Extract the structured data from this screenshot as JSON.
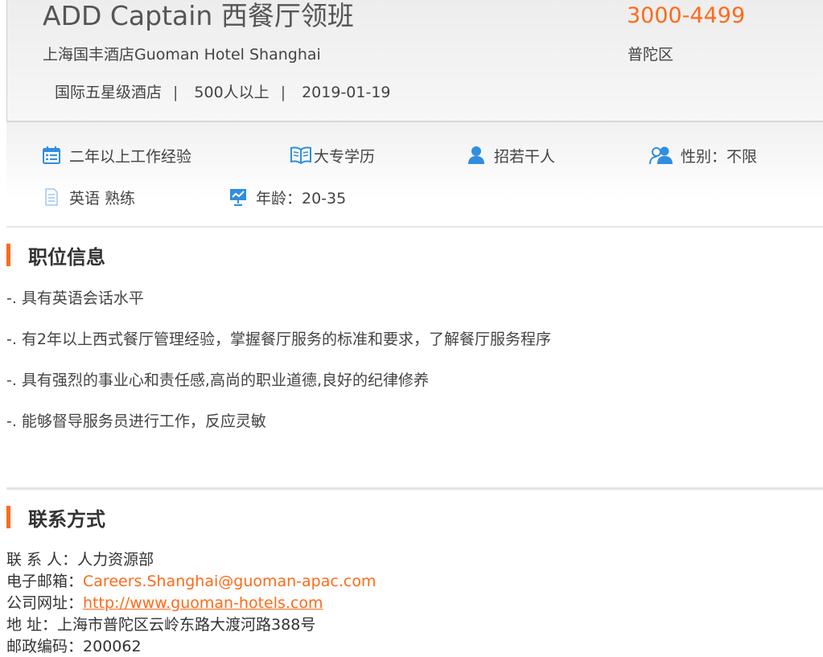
{
  "job": {
    "title": "ADD Captain 西餐厅领班",
    "salary": "3000-4499",
    "company": "上海国丰酒店Guoman Hotel Shanghai",
    "district": "普陀区",
    "company_type": "国际五星级酒店",
    "separator": "|",
    "company_size": "500人以上",
    "post_date": "2019-01-19"
  },
  "requirements": {
    "experience": "二年以上工作经验",
    "education": "大专学历",
    "headcount": "招若干人",
    "gender": "性别：不限",
    "language": "英语 熟练",
    "age": "年龄：20-35"
  },
  "icons": {
    "experience": "calendar-icon",
    "education": "open-book-icon",
    "headcount": "person-icon",
    "gender": "people-icon",
    "language": "document-icon",
    "age": "chart-board-icon",
    "icon_color": "#2f8ee0"
  },
  "sections": {
    "position_info": {
      "title": "职位信息",
      "items": [
        "-. 具有英语会话水平",
        "-. 有2年以上西式餐厅管理经验，掌握餐厅服务的标准和要求，了解餐厅服务程序",
        "-. 具有强烈的事业心和责任感,高尚的职业道德,良好的纪律修养",
        "-. 能够督导服务员进行工作，反应灵敏"
      ]
    },
    "contact": {
      "title": "联系方式",
      "contact_label": "联 系 人：",
      "contact_value": "人力资源部",
      "email_label": "电子邮箱：",
      "email_value": "Careers.Shanghai@guoman-apac.com",
      "website_label": "公司网址：",
      "website_value": "http://www.guoman-hotels.com",
      "address_label": "地 址：",
      "address_value": "上海市普陀区云岭东路大渡河路388号",
      "postcode_label": "邮政编码：",
      "postcode_value": "200062"
    }
  },
  "colors": {
    "accent": "#ff6a1a",
    "icon_blue": "#2f8ee0"
  }
}
